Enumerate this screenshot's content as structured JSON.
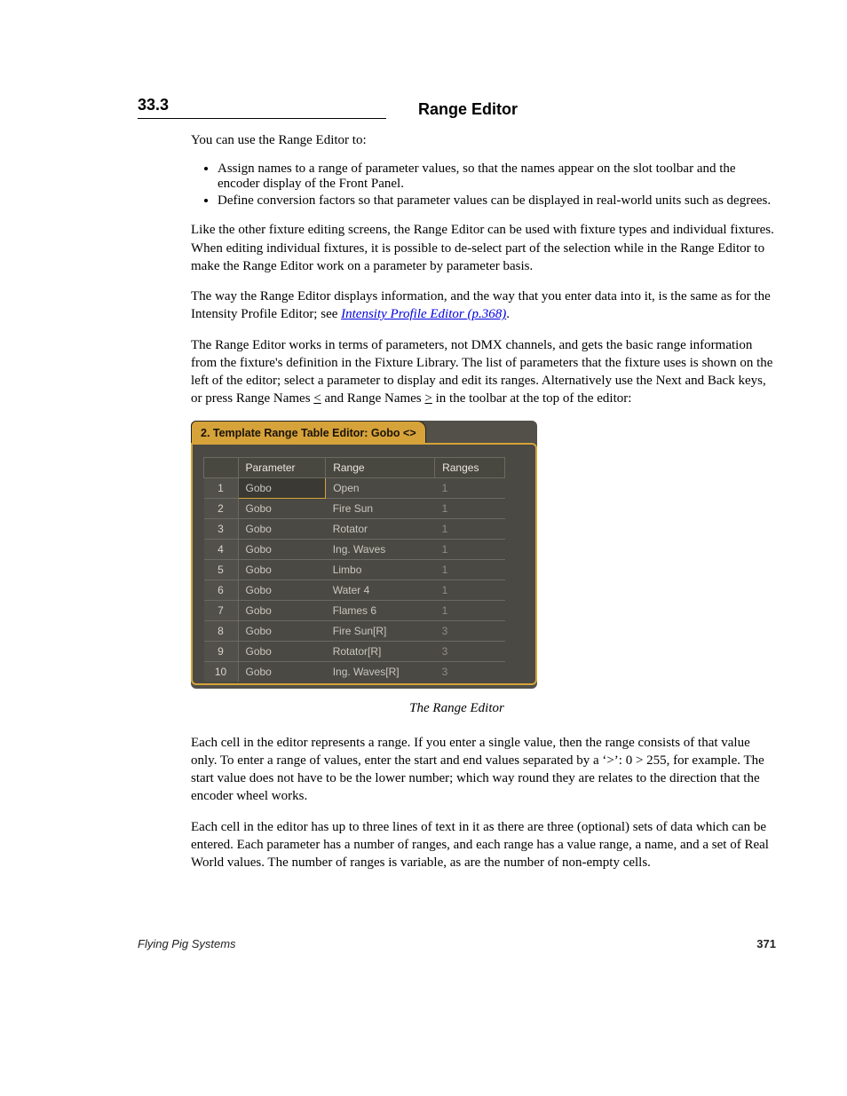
{
  "section": {
    "number": "33.3",
    "title": "Range Editor"
  },
  "intro": "You can use the Range Editor to:",
  "bullets": [
    "Assign names to a range of parameter values, so that the names appear on the slot toolbar and the encoder display of the Front Panel.",
    "Define conversion factors so that parameter values can be displayed in real-world units such as degrees."
  ],
  "para2": "Like the other fixture editing screens, the Range Editor can be used with fixture types and individual fixtures. When editing individual fixtures, it is possible to de-select part of the selection while in the Range Editor to make the Range Editor work on a parameter by parameter basis.",
  "para3_pre": "The way the Range Editor displays information, and the way that you enter data into it, is the same as for the Intensity Profile Editor; see ",
  "para3_link": "Intensity Profile Editor (p.368)",
  "para3_post": ".",
  "para4_pre": "The Range Editor works in terms of parameters, not DMX channels, and gets the basic range information from the fixture's definition in the Fixture Library. The list of parameters that the fixture uses is shown on the left of the editor; select a parameter to display and edit its ranges. Alternatively use the Next and Back keys, or press Range Names ",
  "para4_u": "<",
  "para4_mid": " and Range Names ",
  "para4_u2": ">",
  "para4_post": " in the toolbar at the top of the editor:",
  "editor": {
    "tabTitle": "2. Template Range Table Editor: Gobo <>",
    "headers": [
      "",
      "Parameter",
      "Range",
      "Ranges"
    ],
    "rows": [
      {
        "n": "1",
        "param": "Gobo",
        "range": "Open",
        "ranges": "1",
        "selected": true
      },
      {
        "n": "2",
        "param": "Gobo",
        "range": "Fire Sun",
        "ranges": "1"
      },
      {
        "n": "3",
        "param": "Gobo",
        "range": "Rotator",
        "ranges": "1"
      },
      {
        "n": "4",
        "param": "Gobo",
        "range": "Ing. Waves",
        "ranges": "1"
      },
      {
        "n": "5",
        "param": "Gobo",
        "range": "Limbo",
        "ranges": "1"
      },
      {
        "n": "6",
        "param": "Gobo",
        "range": "Water 4",
        "ranges": "1"
      },
      {
        "n": "7",
        "param": "Gobo",
        "range": "Flames 6",
        "ranges": "1"
      },
      {
        "n": "8",
        "param": "Gobo",
        "range": "Fire Sun[R]",
        "ranges": "3"
      },
      {
        "n": "9",
        "param": "Gobo",
        "range": "Rotator[R]",
        "ranges": "3"
      },
      {
        "n": "10",
        "param": "Gobo",
        "range": "Ing. Waves[R]",
        "ranges": "3"
      }
    ]
  },
  "caption": "The Range Editor",
  "para5": "Each cell in the editor represents a range. If you enter a single value, then the range consists of that value only. To enter a range of values, enter the start and end values separated by a ‘>’: 0 > 255, for example. The start value does not have to be the lower number; which way round they are relates to the direction that the encoder wheel works.",
  "para6": "Each cell in the editor has up to three lines of text in it as there are three (optional) sets of data which can be entered. Each parameter has a number of ranges, and each range has a value range, a name, and a set of Real World values. The number of ranges is variable, as are the number of non-empty cells.",
  "footer": {
    "left": "Flying Pig Systems",
    "right": "371"
  }
}
